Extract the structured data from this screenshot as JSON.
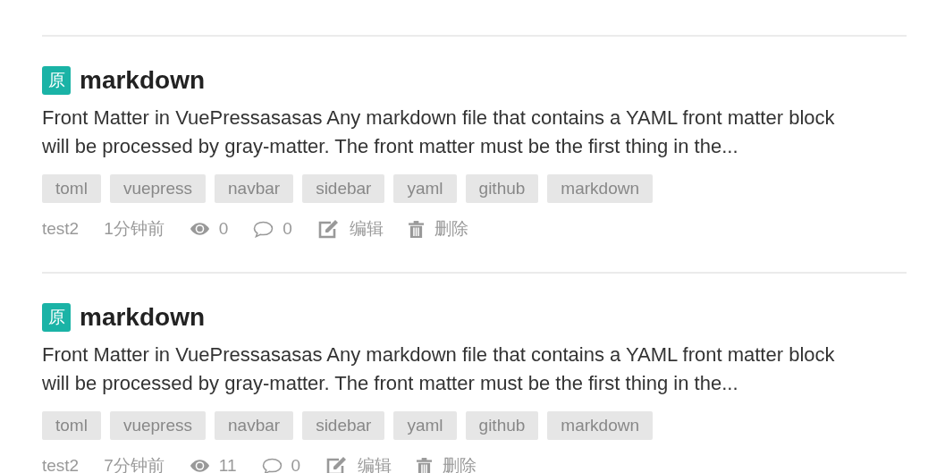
{
  "posts": [
    {
      "badge": "原",
      "title": "markdown",
      "description": "Front Matter in VuePressasasas Any markdown file that contains a YAML front matter block will be processed by gray-matter. The front matter must be the first thing in the...",
      "tags": [
        "toml",
        "vuepress",
        "navbar",
        "sidebar",
        "yaml",
        "github",
        "markdown"
      ],
      "author": "test2",
      "time": "1分钟前",
      "views": "0",
      "comments": "0",
      "edit": "编辑",
      "delete": "删除"
    },
    {
      "badge": "原",
      "title": "markdown",
      "description": "Front Matter in VuePressasasas Any markdown file that contains a YAML front matter block will be processed by gray-matter. The front matter must be the first thing in the...",
      "tags": [
        "toml",
        "vuepress",
        "navbar",
        "sidebar",
        "yaml",
        "github",
        "markdown"
      ],
      "author": "test2",
      "time": "7分钟前",
      "views": "11",
      "comments": "0",
      "edit": "编辑",
      "delete": "删除"
    }
  ]
}
